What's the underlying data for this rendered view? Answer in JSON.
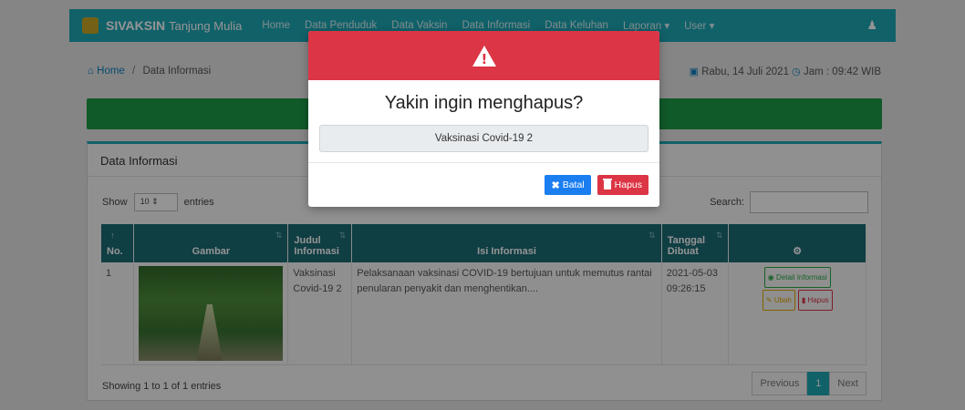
{
  "navbar": {
    "brand_bold": "SIVAKSIN",
    "brand_sub": "Tanjung Mulia",
    "links": [
      "Home",
      "Data Penduduk",
      "Data Vaksin",
      "Data Informasi",
      "Data Keluhan",
      "Laporan ▾",
      "User ▾"
    ]
  },
  "breadcrumb": {
    "home": "Home",
    "current": "Data Informasi"
  },
  "datetime": {
    "date": "Rabu, 14 Juli 2021",
    "time": "Jam : 09:42 WIB"
  },
  "card": {
    "title": "Data Informasi",
    "show_label": "Show",
    "length_value": "10",
    "entries_label": "entries",
    "search_label": "Search:",
    "search_value": ""
  },
  "table": {
    "headers": [
      "No.",
      "Gambar",
      "Judul Informasi",
      "Isi Informasi",
      "Tanggal Dibuat",
      ""
    ],
    "rows": [
      {
        "no": "1",
        "judul": "Vaksinasi Covid-19 2",
        "isi": "Pelaksanaan vaksinasi COVID-19 bertujuan untuk memutus rantai penularan penyakit dan menghentikan....",
        "tanggal": "2021-05-03 09:26:15",
        "btn_detail": "Detail Informasi",
        "btn_ubah": "Ubah",
        "btn_hapus": "Hapus"
      }
    ]
  },
  "footer": {
    "info": "Showing 1 to 1 of 1 entries",
    "prev": "Previous",
    "page": "1",
    "next": "Next"
  },
  "modal": {
    "title": "Yakin ingin menghapus?",
    "item": "Vaksinasi Covid-19 2",
    "cancel_label": "Batal",
    "delete_label": "Hapus"
  },
  "colors": {
    "navbar": "#1ea7b6",
    "danger": "#dc3545",
    "primary": "#1a7ef0",
    "success": "#1d9a45",
    "table_header": "#1a6b74"
  }
}
